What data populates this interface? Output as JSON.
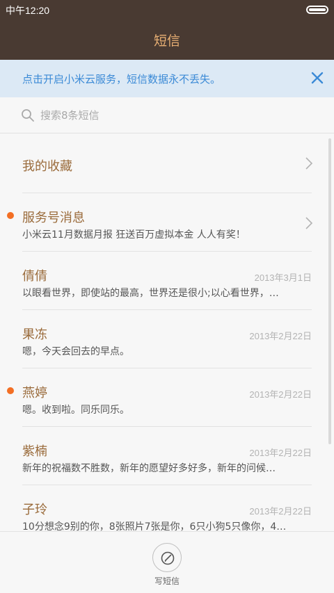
{
  "status_bar": {
    "time": "中午12:20",
    "battery_icon": "battery-icon"
  },
  "header": {
    "title": "短信"
  },
  "banner": {
    "text": "点击开启小米云服务，短信数据永不丢失。",
    "close_icon": "close-icon",
    "color": "#3b8ad6"
  },
  "search": {
    "placeholder": "搜索8条短信",
    "icon": "search-icon"
  },
  "favorites": {
    "label": "我的收藏"
  },
  "messages": [
    {
      "name": "服务号消息",
      "snippet": "小米云11月数据月报 狂送百万虚拟本金 人人有奖！",
      "date": "",
      "unread": true
    },
    {
      "name": "倩倩",
      "snippet": "以眼看世界，即使站的最高，世界还是很小;以心看世界，…",
      "date": "2013年3月1日",
      "unread": false
    },
    {
      "name": "果冻",
      "snippet": "嗯，今天会回去的早点。",
      "date": "2013年2月22日",
      "unread": false
    },
    {
      "name": "燕婷",
      "snippet": "嗯。收到啦。同乐同乐。",
      "date": "2013年2月22日",
      "unread": true
    },
    {
      "name": "紫楠",
      "snippet": "新年的祝福数不胜数，新年的愿望好多好多，新年的问候…",
      "date": "2013年2月22日",
      "unread": false
    },
    {
      "name": "子玲",
      "snippet": "10分想念9别的你，8张照片7张是你，6只小狗5只像你，4…",
      "date": "2013年2月22日",
      "unread": false
    }
  ],
  "bottom": {
    "compose_label": "写短信",
    "compose_icon": "compose-icon"
  },
  "colors": {
    "header_bg": "#493a32",
    "title": "#e9b074",
    "name": "#9a6b3b",
    "unread_dot": "#f36f24"
  }
}
